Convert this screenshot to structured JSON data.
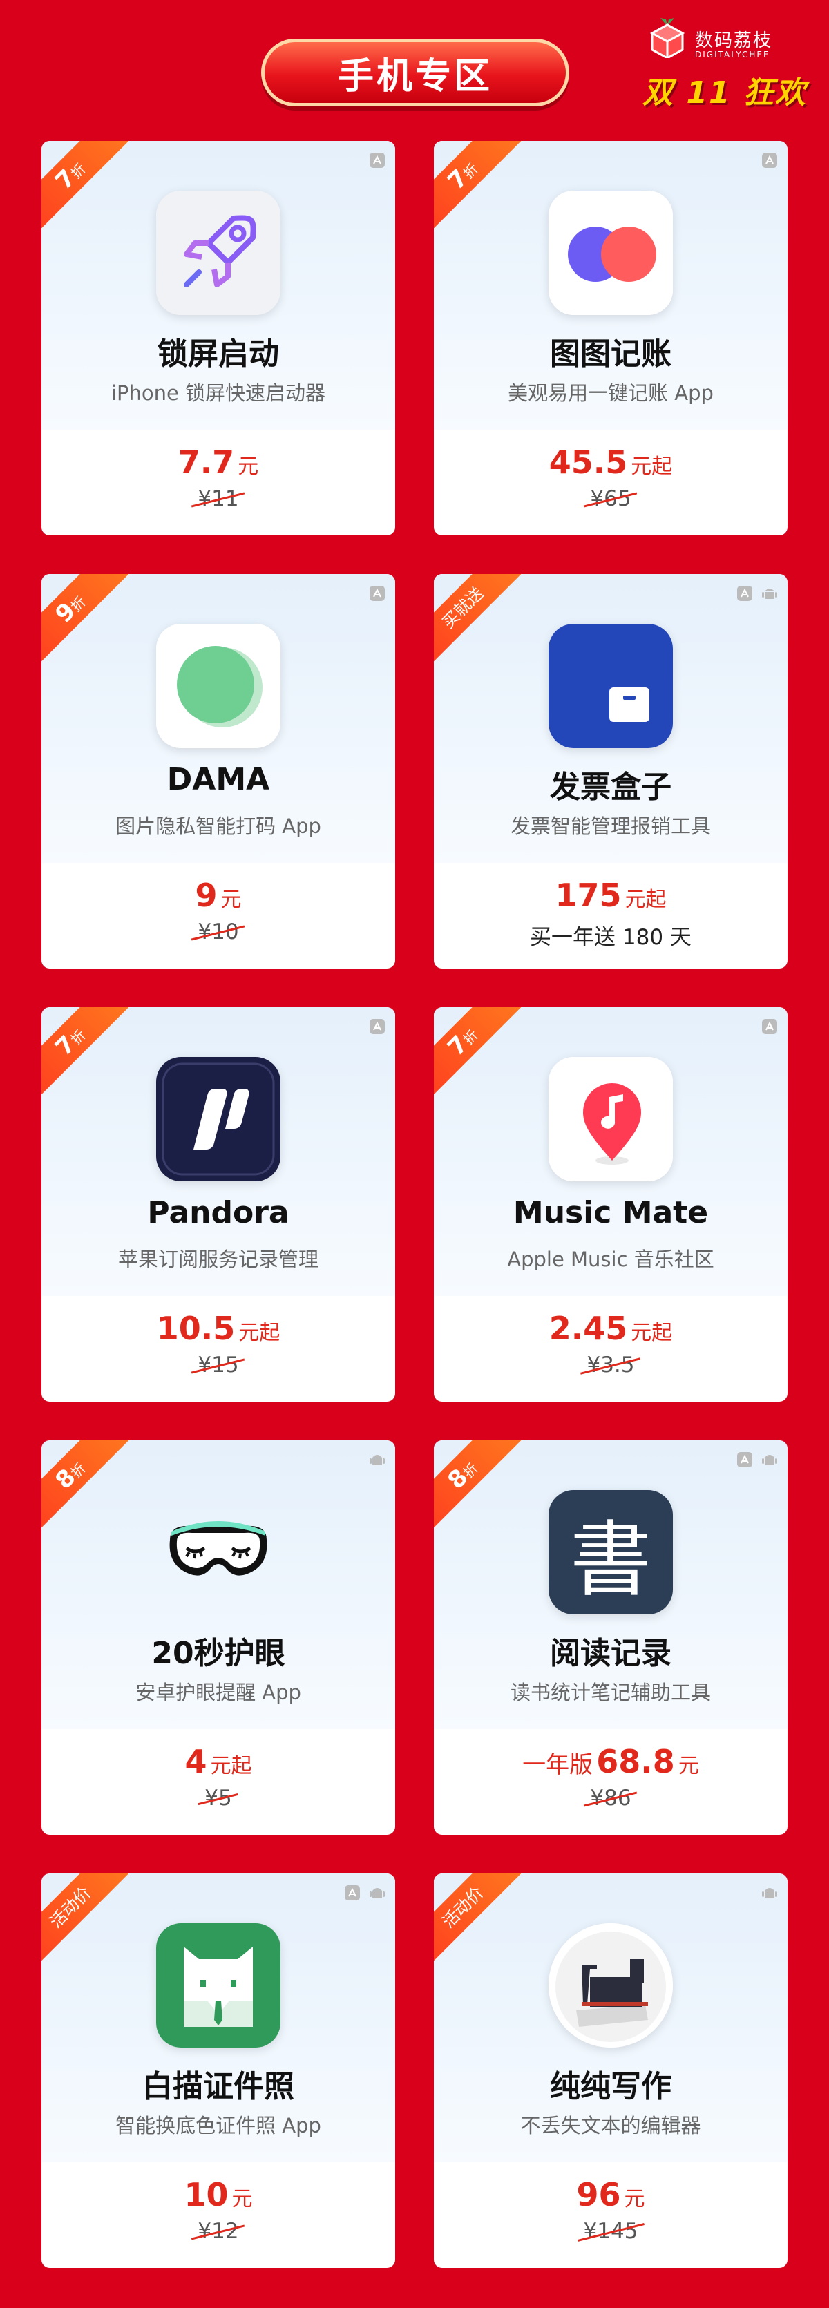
{
  "header": {
    "title": "手机专区"
  },
  "brand": {
    "name": "数码荔枝",
    "name_en": "DIGITALYCHEE",
    "event": "双 11 狂欢"
  },
  "colors": {
    "background": "#d9001b",
    "price": "#e0291c",
    "ribbon": "#ff5a1e"
  },
  "cards": [
    {
      "ribbon": "7折",
      "platforms": [
        "app-store-icon"
      ],
      "icon": "rocket-icon",
      "name": "锁屏启动",
      "desc": "iPhone 锁屏快速启动器",
      "price_prefix": "",
      "price": "7.7",
      "unit": "元",
      "orig": "¥11"
    },
    {
      "ribbon": "7折",
      "platforms": [
        "app-store-icon"
      ],
      "icon": "two-dots-icon",
      "name": "图图记账",
      "desc": "美观易用一键记账 App",
      "price_prefix": "",
      "price": "45.5",
      "unit": "元起",
      "orig": "¥65"
    },
    {
      "ribbon": "9折",
      "platforms": [
        "app-store-icon"
      ],
      "icon": "green-circle-icon",
      "name": "DAMA",
      "desc": "图片隐私智能打码 App",
      "price_prefix": "",
      "price": "9",
      "unit": "元",
      "orig": "¥10"
    },
    {
      "ribbon": "买就送",
      "platforms": [
        "app-store-icon",
        "android-icon"
      ],
      "icon": "invoice-box-icon",
      "name": "发票盒子",
      "desc": "发票智能管理报销工具",
      "price_prefix": "",
      "price": "175",
      "unit": "元起",
      "orig": "买一年送 180 天"
    },
    {
      "ribbon": "7折",
      "platforms": [
        "app-store-icon"
      ],
      "icon": "pandora-icon",
      "name": "Pandora",
      "desc": "苹果订阅服务记录管理",
      "price_prefix": "",
      "price": "10.5",
      "unit": "元起",
      "orig": "¥15"
    },
    {
      "ribbon": "7折",
      "platforms": [
        "app-store-icon"
      ],
      "icon": "music-pin-icon",
      "name": "Music Mate",
      "desc": "Apple Music 音乐社区",
      "price_prefix": "",
      "price": "2.45",
      "unit": "元起",
      "orig": "¥3.5"
    },
    {
      "ribbon": "8折",
      "platforms": [
        "android-icon"
      ],
      "icon": "sleep-mask-icon",
      "name": "20秒护眼",
      "desc": "安卓护眼提醒 App",
      "price_prefix": "",
      "price": "4",
      "unit": "元起",
      "orig": "¥5"
    },
    {
      "ribbon": "8折",
      "platforms": [
        "app-store-icon",
        "android-icon"
      ],
      "icon": "book-char-icon",
      "name": "阅读记录",
      "desc": "读书统计笔记辅助工具",
      "price_prefix": "一年版",
      "price": "68.8",
      "unit": "元",
      "orig": "¥86",
      "icon_char": "書"
    },
    {
      "ribbon": "活动价",
      "platforms": [
        "app-store-icon",
        "android-icon"
      ],
      "icon": "id-photo-icon",
      "name": "白描证件照",
      "desc": "智能换底色证件照 App",
      "price_prefix": "",
      "price": "10",
      "unit": "元",
      "orig": "¥12"
    },
    {
      "ribbon": "活动价",
      "platforms": [
        "android-icon"
      ],
      "icon": "typewriter-icon",
      "name": "纯纯写作",
      "desc": "不丢失文本的编辑器",
      "price_prefix": "",
      "price": "96",
      "unit": "元",
      "orig": "¥145"
    }
  ]
}
